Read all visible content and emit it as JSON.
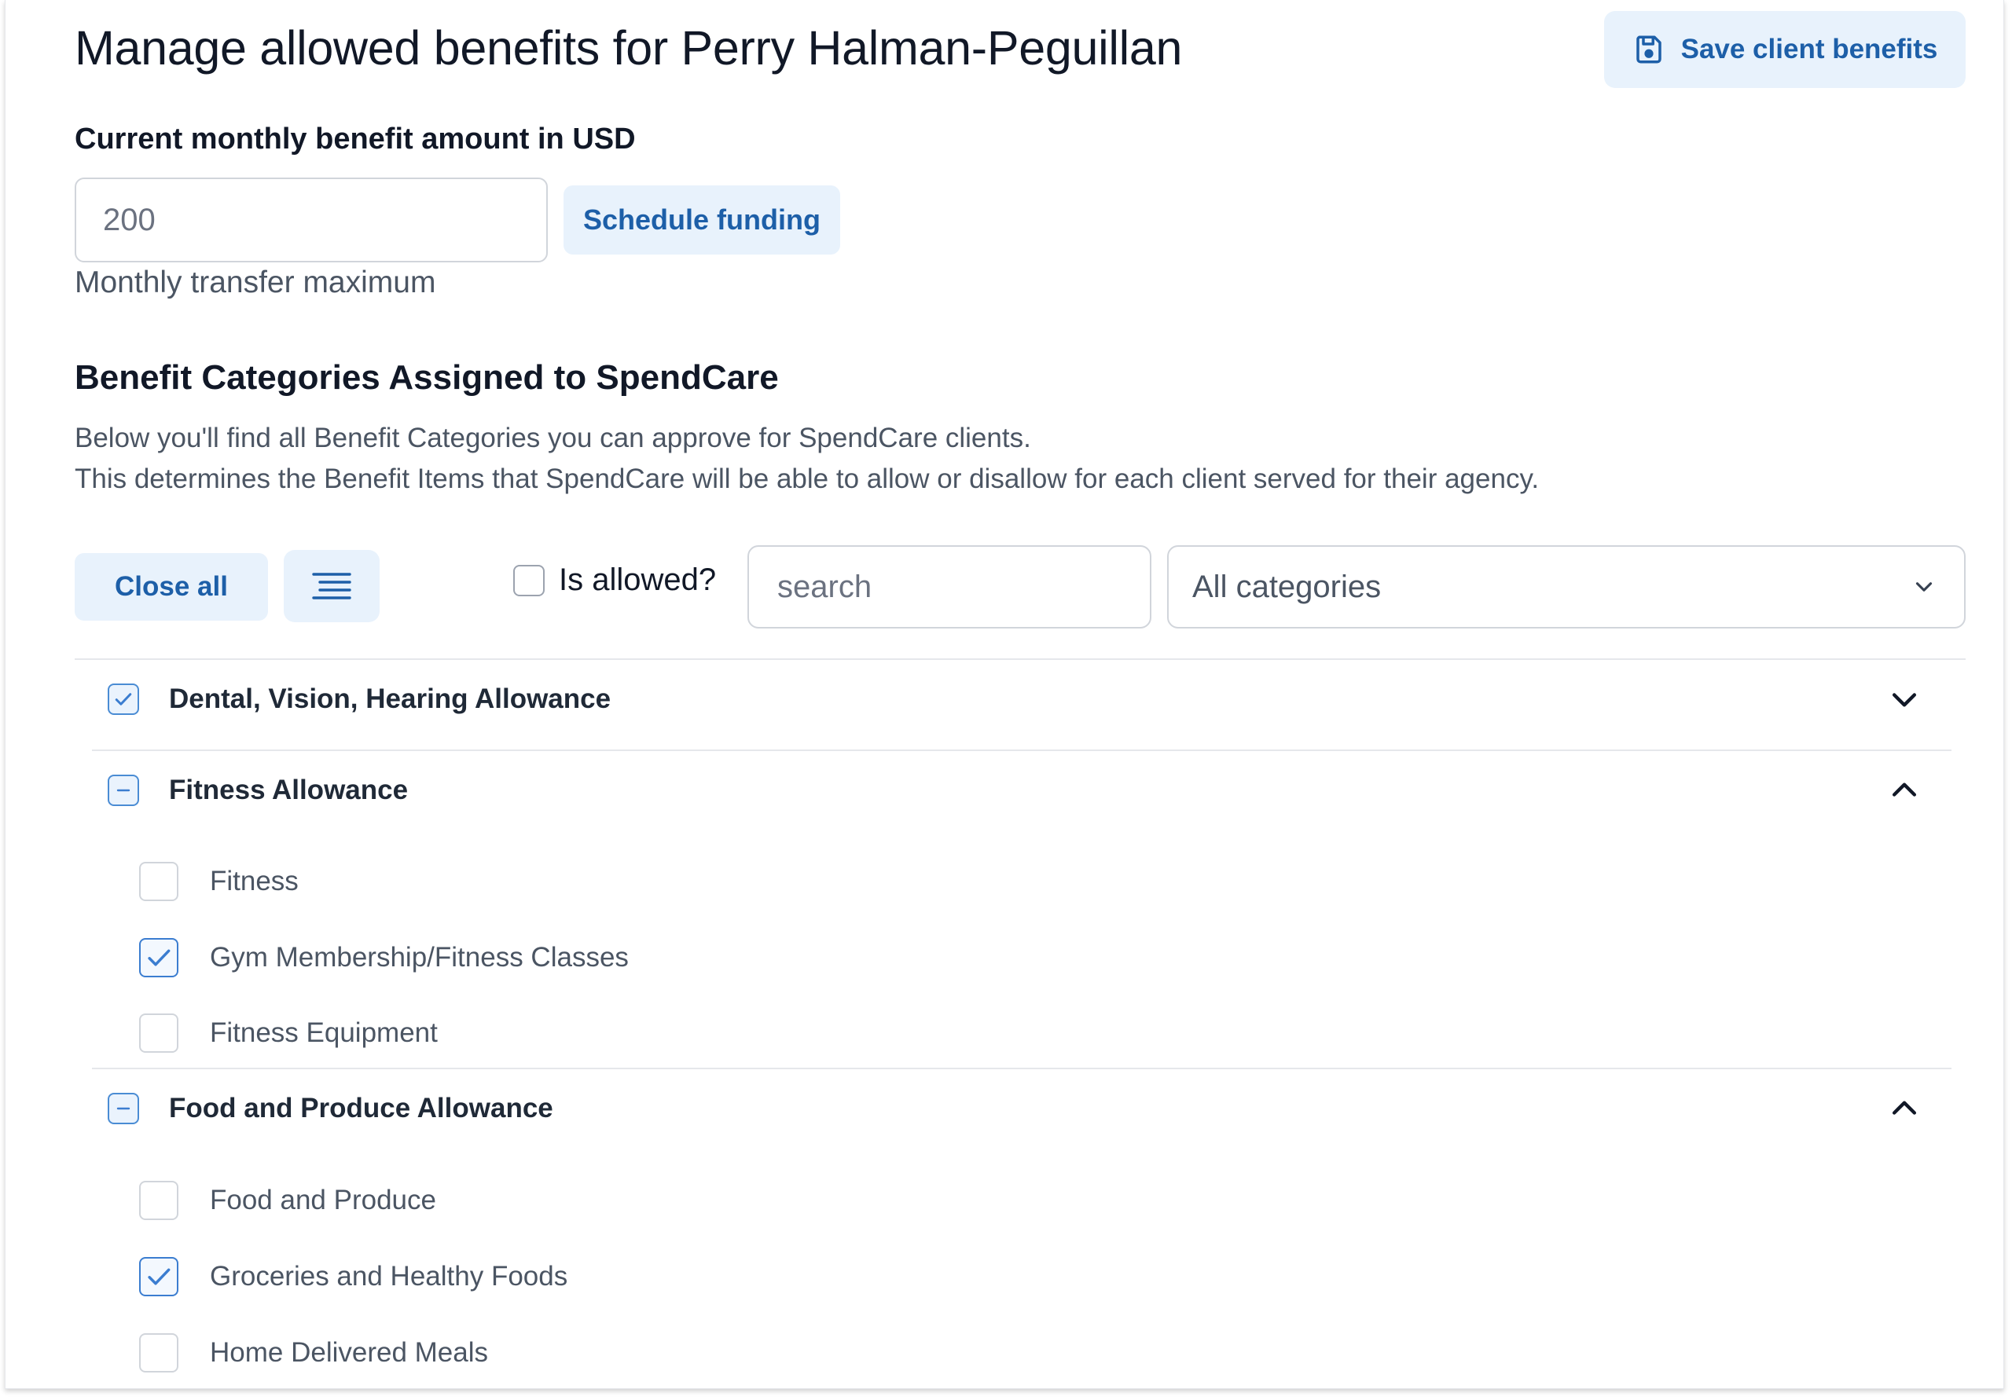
{
  "header": {
    "title": "Manage allowed benefits for Perry Halman-Peguillan",
    "save_label": "Save client benefits"
  },
  "amount": {
    "label": "Current monthly benefit amount in USD",
    "value": "200",
    "schedule_label": "Schedule funding",
    "helper": "Monthly transfer maximum"
  },
  "section": {
    "title": "Benefit Categories Assigned to SpendCare",
    "desc1": "Below you'll find all Benefit Categories you can approve for SpendCare clients.",
    "desc2": "This determines the Benefit Items that SpendCare will be able to allow or disallow for each client served for their agency."
  },
  "toolbar": {
    "close_all_label": "Close all",
    "list_icon": "list-lines-icon",
    "allowed_label": "Is allowed?",
    "allowed_checked": false,
    "search_value": "search",
    "category_select_value": "All categories"
  },
  "groups": [
    {
      "label": "Dental, Vision, Hearing Allowance",
      "state": "checked",
      "expanded": false,
      "items": []
    },
    {
      "label": "Fitness Allowance",
      "state": "partial",
      "expanded": true,
      "items": [
        {
          "label": "Fitness",
          "checked": false
        },
        {
          "label": "Gym Membership/Fitness Classes",
          "checked": true
        },
        {
          "label": "Fitness Equipment",
          "checked": false
        }
      ]
    },
    {
      "label": "Food and Produce Allowance",
      "state": "partial",
      "expanded": true,
      "items": [
        {
          "label": "Food and Produce",
          "checked": false
        },
        {
          "label": "Groceries and Healthy Foods",
          "checked": true
        },
        {
          "label": "Home Delivered Meals",
          "checked": false
        }
      ]
    }
  ],
  "colors": {
    "accent": "#1d5fa8",
    "accent_bg": "#e8f2fc",
    "checkbox_border": "#4a8cd4"
  }
}
